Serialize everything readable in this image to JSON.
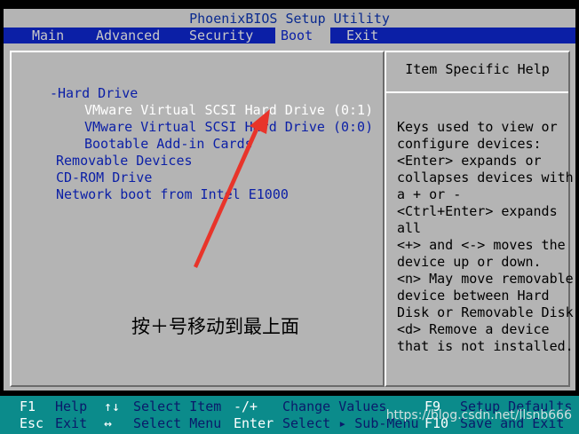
{
  "title": "PhoenixBIOS Setup Utility",
  "menu": [
    {
      "label": "Main",
      "active": false
    },
    {
      "label": "Advanced",
      "active": false
    },
    {
      "label": "Security",
      "active": false
    },
    {
      "label": "Boot",
      "active": true
    },
    {
      "label": "Exit",
      "active": false
    }
  ],
  "boot_list": {
    "hard_drive": "-Hard Drive",
    "hd_item_1": "VMware Virtual SCSI Hard Drive (0:1)",
    "hd_item_2": "VMware Virtual SCSI Hard Drive (0:0)",
    "hd_item_3": "Bootable Add-in Cards",
    "removable": "Removable Devices",
    "cdrom": "CD-ROM Drive",
    "network": "Network boot from Intel E1000"
  },
  "help": {
    "title": "Item Specific Help",
    "lines": [
      "Keys used to view or",
      "configure devices:",
      "<Enter> expands or",
      "collapses devices with",
      "a + or -",
      "<Ctrl+Enter> expands",
      "all",
      "<+> and <-> moves the",
      "device up or down.",
      "<n> May move removable",
      "device between Hard",
      "Disk or Removable Disk",
      "<d> Remove a device",
      "that is not installed."
    ]
  },
  "annotation": "按＋号移动到最上面",
  "footer": {
    "row1": {
      "k1": "F1",
      "d1": "Help",
      "k2": "↑↓",
      "d2": "Select Item",
      "k3": "-/+",
      "d3": "Change Values",
      "k4": "F9",
      "d4": "Setup Defaults"
    },
    "row2": {
      "k1": "Esc",
      "d1": "Exit",
      "k2": "↔",
      "d2": "Select Menu",
      "k3": "Enter",
      "d3": "Select ▸ Sub-Menu",
      "k4": "F10",
      "d4": "Save and Exit"
    }
  },
  "watermark": "https://blog.csdn.net/llsnb666",
  "colors": {
    "menubar": "#0b1fa6",
    "panel": "#b4b4b4",
    "footer": "#0b8b8b",
    "arrow": "#e8342a"
  }
}
